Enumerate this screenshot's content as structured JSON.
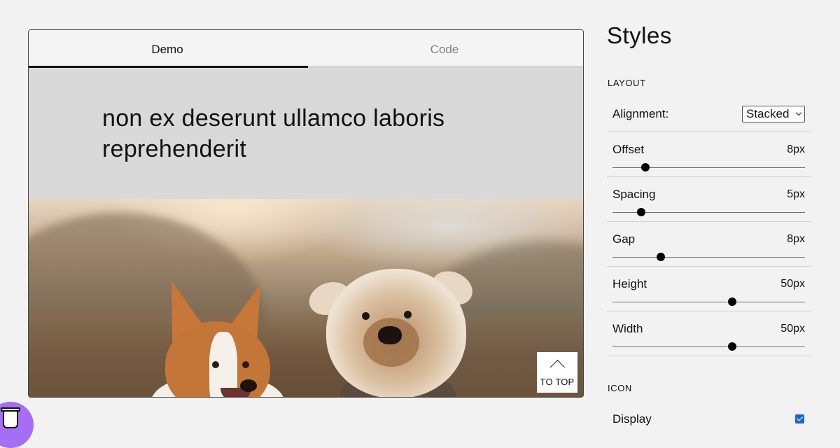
{
  "tabs": {
    "demo_label": "Demo",
    "code_label": "Code",
    "active": "Demo"
  },
  "demo": {
    "heading": "non ex deserunt ullamco laboris reprehenderit",
    "photo_icon": "dogs-photo",
    "to_top_label": "TO TOP",
    "to_top_icon": "chevron-up-icon"
  },
  "styles": {
    "title": "Styles",
    "layout_section": "LAYOUT",
    "alignment": {
      "label": "Alignment:",
      "value": "Stacked"
    },
    "offset": {
      "label": "Offset",
      "value": "8px",
      "level": 0.17
    },
    "spacing": {
      "label": "Spacing",
      "value": "5px",
      "level": 0.15
    },
    "gap": {
      "label": "Gap",
      "value": "8px",
      "level": 0.25
    },
    "height": {
      "label": "Height",
      "value": "50px",
      "level": 0.62
    },
    "width": {
      "label": "Width",
      "value": "50px",
      "level": 0.62
    },
    "icon_section": "ICON",
    "display": {
      "label": "Display",
      "checked": true
    }
  },
  "floating": {
    "icon": "coffee-cup-icon",
    "color": "#a56ef4"
  },
  "colors": {
    "checkbox": "#1a66d1",
    "slider_thumb": "#000000"
  }
}
